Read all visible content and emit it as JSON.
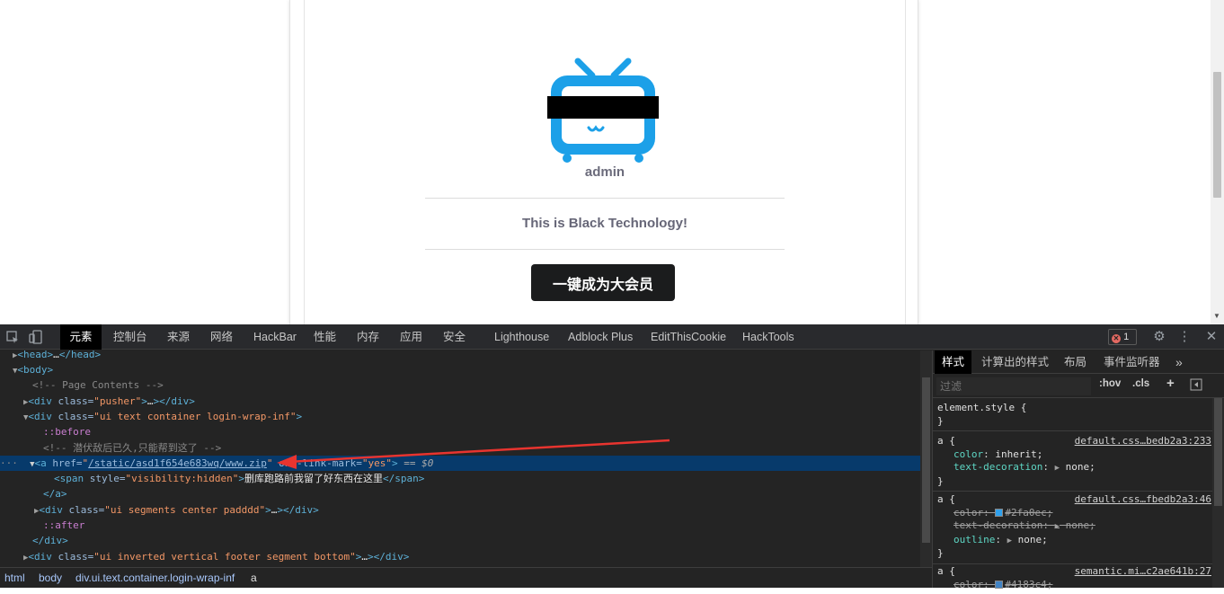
{
  "page": {
    "username": "admin",
    "tagline": "This is Black Technology!",
    "vip_button": "一键成为大会员"
  },
  "devtools": {
    "tabs": [
      "元素",
      "控制台",
      "来源",
      "网络",
      "HackBar",
      "性能",
      "内存",
      "应用",
      "安全",
      "Lighthouse",
      "Adblock Plus",
      "EditThisCookie",
      "HackTools"
    ],
    "active_tab": "元素",
    "error_count": "1",
    "tree": {
      "head_tag": "<head>",
      "head_close": "</head>",
      "body_tag": "<body>",
      "comment_page_contents": "<!-- Page Contents -->",
      "pusher_div": "<div ",
      "pusher_attr": "class=",
      "pusher_val": "\"pusher\"",
      "pusher_close": "></div>",
      "container_div": "<div ",
      "container_attr": "class=",
      "container_val": "\"ui text container login-wrap-inf\"",
      "container_end": ">",
      "before": "::before",
      "comment_hidden": "<!-- 潜伏敌后已久,只能帮到这了 -->",
      "a_open": "<a ",
      "a_href_attr": "href=",
      "a_href_val": "/static/asd1f654e683wq/www.zip",
      "a_extra_attr": "one-link-mark=",
      "a_extra_val": "\"yes\"",
      "a_end": ">",
      "a_dollar": "== $0",
      "span_open": "<span ",
      "span_attr": "style=",
      "span_val": "\"visibility:hidden\"",
      "span_text": "删库跑路前我留了好东西在这里",
      "span_close": "</span>",
      "a_close": "</a>",
      "segments_div": "<div ",
      "segments_attr": "class=",
      "segments_val": "\"ui segments center padddd\"",
      "segments_close": "></div>",
      "after": "::after",
      "div_close": "</div>",
      "footer_div": "<div ",
      "footer_attr": "class=",
      "footer_val": "\"ui inverted vertical footer segment bottom\"",
      "footer_close": "></div>"
    },
    "breadcrumbs": [
      "html",
      "body",
      "div.ui.text.container.login-wrap-inf",
      "a"
    ],
    "styles": {
      "tabs": [
        "样式",
        "计算出的样式",
        "布局",
        "事件监听器"
      ],
      "filter_placeholder": "过滤",
      "hov": ":hov",
      "cls": ".cls",
      "element_style": "element.style {",
      "close_brace": "}",
      "rules": [
        {
          "selector": "a {",
          "source": "default.css…bedb2a3:233",
          "props": [
            {
              "name": "color",
              "value": "inherit;"
            },
            {
              "name": "text-decoration",
              "value": "none;"
            }
          ]
        },
        {
          "selector": "a {",
          "source": "default.css…fbedb2a3:46",
          "props": [
            {
              "name": "color",
              "value": "#2fa0ec;"
            },
            {
              "name": "text-decoration",
              "value": "none;"
            },
            {
              "name": "outline",
              "value": "none;"
            }
          ]
        },
        {
          "selector": "a {",
          "source": "semantic.mi…c2ae641b:27",
          "props": [
            {
              "name": "color",
              "value": "#4183c4;"
            }
          ]
        }
      ]
    }
  },
  "colors": {
    "tv_blue": "#1ca0e8",
    "selected_row": "#073a6b",
    "swatch_1": "#2fa0ec",
    "swatch_2": "#4183c4"
  }
}
